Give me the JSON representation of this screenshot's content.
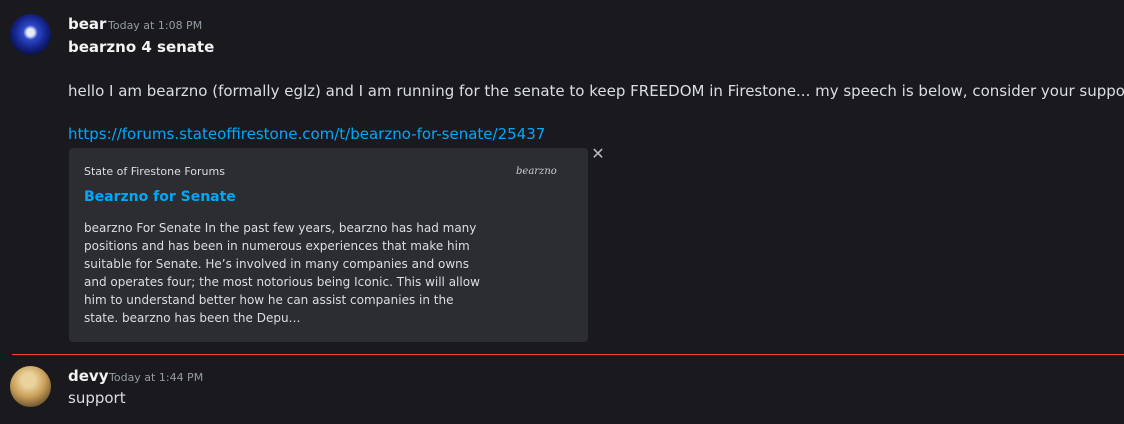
{
  "messages": [
    {
      "author": "bear",
      "timestamp": "Today at 1:08 PM",
      "title": "bearzno 4 senate",
      "text": "hello I am bearzno (formally eglz) and I am running for the senate to keep FREEDOM in Firestone... my speech is below, consider your support.",
      "link": "https://forums.stateoffirestone.com/t/bearzno-for-senate/25437",
      "embed": {
        "provider": "State of Firestone Forums",
        "title": "Bearzno for Senate",
        "description": "bearzno For Senate In the past few years, bearzno has had many positions and has been in numerous experiences that make him suitable for Senate. He’s involved in many companies and owns and operates four; the most notorious being Iconic. This will allow him to understand better how he can assist companies in the state. bearzno has been the Depu…",
        "thumbnail_text": "bearzno"
      }
    },
    {
      "author": "devy",
      "timestamp": "Today at 1:44 PM",
      "text": "support"
    }
  ],
  "colors": {
    "background": "#1a1a1e",
    "link": "#00a8fc",
    "embed_bg": "#2b2d31",
    "new_divider": "#f23f42"
  }
}
